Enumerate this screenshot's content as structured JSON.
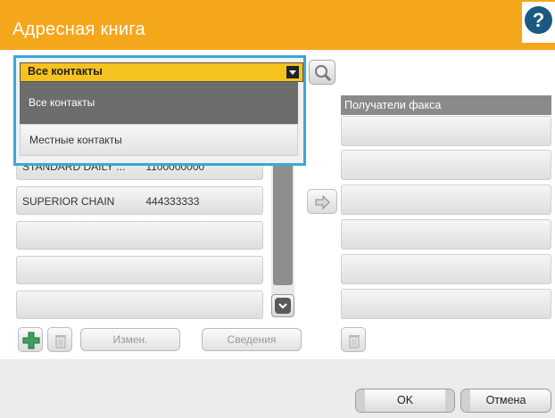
{
  "header": {
    "title": "Адресная книга",
    "help_glyph": "?"
  },
  "dropdown": {
    "selected": "Все контакты",
    "options": [
      "Все контакты",
      "Местные контакты"
    ]
  },
  "contacts": [
    {
      "name": "STANDARD DAILY ...",
      "number": "1100000000"
    },
    {
      "name": "SUPERIOR CHAIN",
      "number": "444333333"
    },
    {
      "name": "",
      "number": ""
    },
    {
      "name": "",
      "number": ""
    },
    {
      "name": "",
      "number": ""
    }
  ],
  "fax_recipients": {
    "header": "Получатели факса"
  },
  "toolbar": {
    "edit_label": "Измен.",
    "details_label": "Сведения"
  },
  "footer": {
    "ok_label": "OK",
    "cancel_label": "Отмена"
  },
  "icons": {
    "help": "help-icon",
    "search": "search-icon",
    "add": "add-contact-icon",
    "delete": "trash-icon",
    "arrow": "arrow-right-icon",
    "scroll_down": "chevron-down-icon",
    "caret": "dropdown-caret-icon"
  },
  "colors": {
    "header": "#f5a71c",
    "dropdown_select": "#f6c31e",
    "dropdown_highlight": "#3aa7d8",
    "selected_option": "#6d6d6d",
    "fax_header": "#8a8a8a",
    "help_circle": "#1b5a80"
  }
}
